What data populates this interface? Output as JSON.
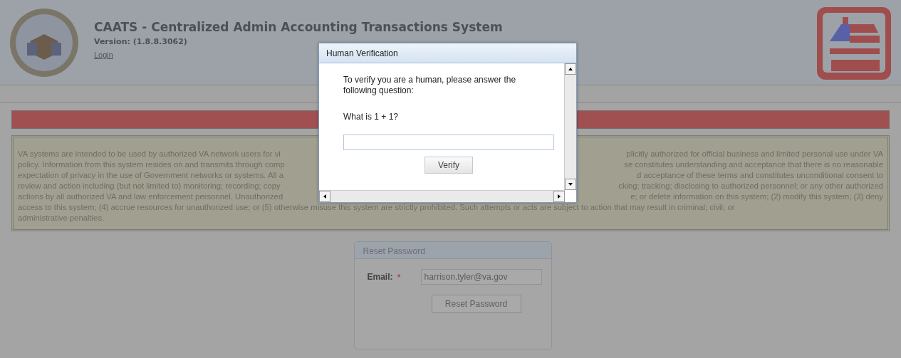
{
  "header": {
    "title": "CAATS - Centralized Admin Accounting Transactions System",
    "version": "Version: (1.8.8.3062)",
    "login_link": "Login"
  },
  "notice": {
    "lines": [
      {
        "left": "VA systems are intended to be used by authorized VA network users for vi",
        "right": "plicitly authorized for official business and limited personal use under VA"
      },
      {
        "left": "policy. Information from this system resides on and transmits through comp",
        "right": "se constitutes understanding and acceptance that there is no reasonable"
      },
      {
        "left": "expectation of privacy in the use of Government networks or systems. All a",
        "right": "d acceptance of these terms and constitutes unconditional consent to"
      },
      {
        "left": "review and action including (but not limited to) monitoring; recording; copy",
        "right": "cking; tracking; disclosing to authorized personnel; or any other authorized"
      },
      {
        "left": "actions by all authorized VA and law enforcement personnel. Unauthorized",
        "right": "e; or delete information on this system; (2) modify this system; (3) deny"
      },
      {
        "left": "access to this system; (4) accrue resources for unauthorized use; or (5) otherwise misuse this system are strictly prohibited. Such attempts or acts are subject to action that may result in criminal; civil; or"
      },
      {
        "left": "administrative penalties."
      }
    ]
  },
  "reset_panel": {
    "title": "Reset Password",
    "email_label": "Email:",
    "required_mark": "*",
    "email_value": "harrison.tyler@va.gov",
    "button": "Reset Password"
  },
  "dialog": {
    "title": "Human Verification",
    "prompt": "To verify you are a human, please answer the following question:",
    "question": "What is 1 + 1?",
    "button": "Verify"
  }
}
